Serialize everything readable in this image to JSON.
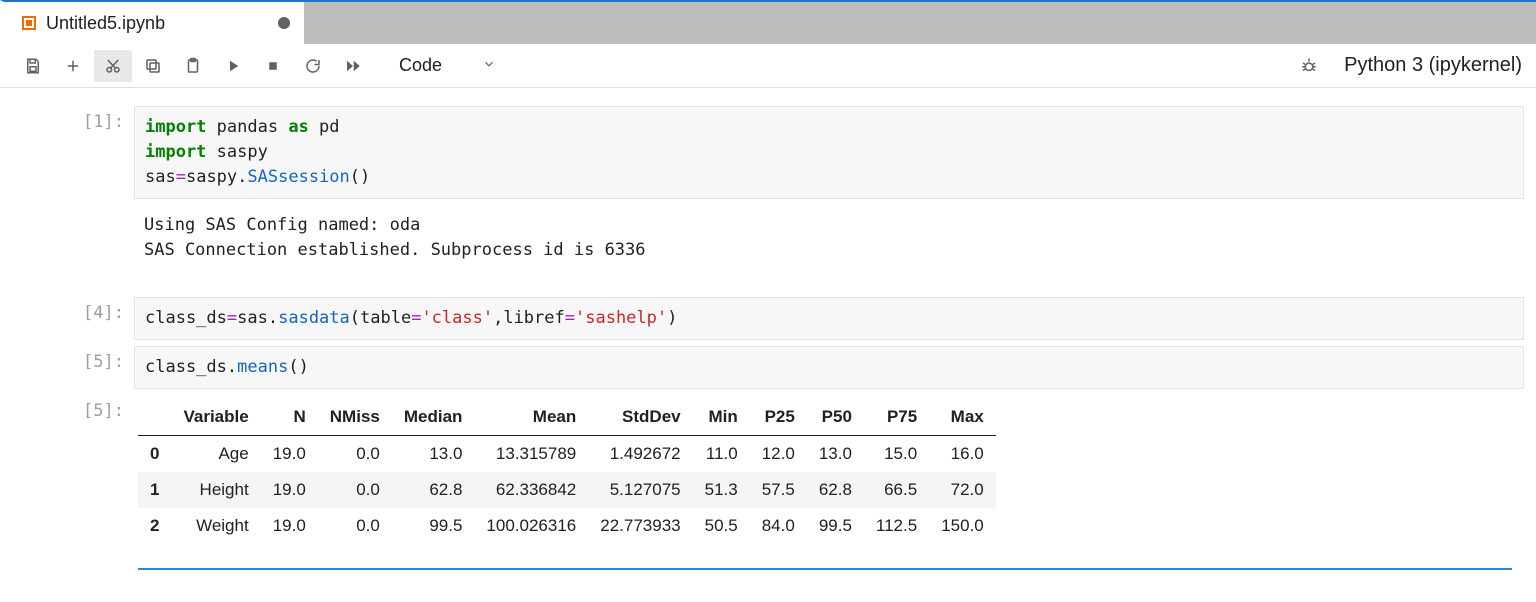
{
  "tab": {
    "title": "Untitled5.ipynb",
    "dirty": true
  },
  "toolbar": {
    "cell_type": "Code"
  },
  "kernel": {
    "display_name": "Python 3 (ipykernel)"
  },
  "cells": [
    {
      "prompt": "[1]:",
      "code_tokens": [
        {
          "t": "import",
          "c": "kw"
        },
        {
          "t": " pandas ",
          "c": "name"
        },
        {
          "t": "as",
          "c": "kw"
        },
        {
          "t": " pd",
          "c": "name"
        },
        {
          "t": "\n",
          "c": ""
        },
        {
          "t": "import",
          "c": "kw"
        },
        {
          "t": " saspy",
          "c": "name"
        },
        {
          "t": "\n",
          "c": ""
        },
        {
          "t": "sas",
          "c": "name"
        },
        {
          "t": "=",
          "c": "op"
        },
        {
          "t": "saspy",
          "c": "name"
        },
        {
          "t": ".",
          "c": "name"
        },
        {
          "t": "SASsession",
          "c": "call"
        },
        {
          "t": "()",
          "c": "name"
        }
      ],
      "stdout": "Using SAS Config named: oda\nSAS Connection established. Subprocess id is 6336"
    },
    {
      "prompt": "[4]:",
      "code_tokens": [
        {
          "t": "class_ds",
          "c": "name"
        },
        {
          "t": "=",
          "c": "op"
        },
        {
          "t": "sas",
          "c": "name"
        },
        {
          "t": ".",
          "c": "name"
        },
        {
          "t": "sasdata",
          "c": "call"
        },
        {
          "t": "(table",
          "c": "name"
        },
        {
          "t": "=",
          "c": "op"
        },
        {
          "t": "'class'",
          "c": "str"
        },
        {
          "t": ",libref",
          "c": "name"
        },
        {
          "t": "=",
          "c": "op"
        },
        {
          "t": "'sashelp'",
          "c": "str"
        },
        {
          "t": ")",
          "c": "name"
        }
      ]
    },
    {
      "prompt": "[5]:",
      "code_tokens": [
        {
          "t": "class_ds",
          "c": "name"
        },
        {
          "t": ".",
          "c": "name"
        },
        {
          "t": "means",
          "c": "call"
        },
        {
          "t": "()",
          "c": "name"
        }
      ]
    }
  ],
  "output_prompt": "[5]:",
  "df": {
    "columns": [
      "Variable",
      "N",
      "NMiss",
      "Median",
      "Mean",
      "StdDev",
      "Min",
      "P25",
      "P50",
      "P75",
      "Max"
    ],
    "index": [
      "0",
      "1",
      "2"
    ],
    "rows": [
      [
        "Age",
        "19.0",
        "0.0",
        "13.0",
        "13.315789",
        "1.492672",
        "11.0",
        "12.0",
        "13.0",
        "15.0",
        "16.0"
      ],
      [
        "Height",
        "19.0",
        "0.0",
        "62.8",
        "62.336842",
        "5.127075",
        "51.3",
        "57.5",
        "62.8",
        "66.5",
        "72.0"
      ],
      [
        "Weight",
        "19.0",
        "0.0",
        "99.5",
        "100.026316",
        "22.773933",
        "50.5",
        "84.0",
        "99.5",
        "112.5",
        "150.0"
      ]
    ]
  }
}
